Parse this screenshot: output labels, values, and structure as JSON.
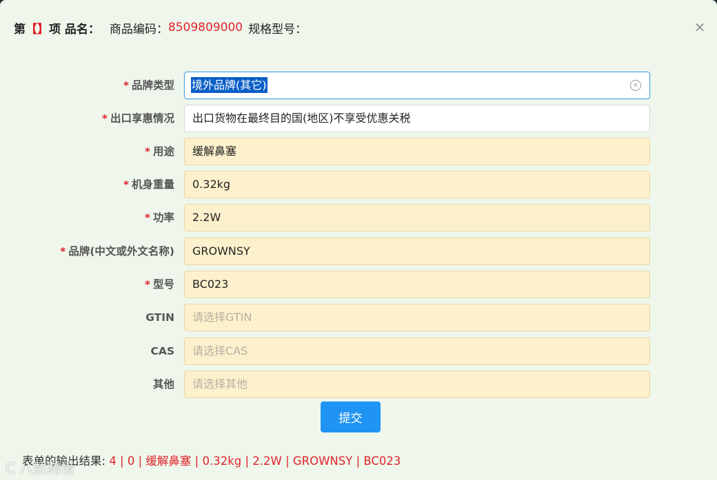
{
  "header": {
    "prefix": "第",
    "bracket": "【】",
    "item_label": "项 品名：",
    "code_label": "商品编码：",
    "code_value": "8509809000",
    "spec_label": "规格型号："
  },
  "close_glyph": "×",
  "form": {
    "rows": [
      {
        "label": "品牌类型",
        "required": true,
        "value": "境外品牌(其它)",
        "placeholder": ""
      },
      {
        "label": "出口享惠情况",
        "required": true,
        "value": "出口货物在最终目的国(地区)不享受优惠关税",
        "placeholder": ""
      },
      {
        "label": "用途",
        "required": true,
        "value": "缓解鼻塞",
        "placeholder": ""
      },
      {
        "label": "机身重量",
        "required": true,
        "value": "0.32kg",
        "placeholder": ""
      },
      {
        "label": "功率",
        "required": true,
        "value": "2.2W",
        "placeholder": ""
      },
      {
        "label": "品牌(中文或外文名称)",
        "required": true,
        "value": "GROWNSY",
        "placeholder": ""
      },
      {
        "label": "型号",
        "required": true,
        "value": "BC023",
        "placeholder": ""
      },
      {
        "label": "GTIN",
        "required": false,
        "value": "",
        "placeholder": "请选择GTIN"
      },
      {
        "label": "CAS",
        "required": false,
        "value": "",
        "placeholder": "请选择CAS"
      },
      {
        "label": "其他",
        "required": false,
        "value": "",
        "placeholder": "请选择其他"
      }
    ],
    "required_mark": "*",
    "clear_glyph": "×"
  },
  "submit_label": "提交",
  "result": {
    "label": "表单的输出结果:",
    "value": "4 | 0 | 缓解鼻塞 | 0.32kg | 2.2W | GROWNSY | BC023"
  },
  "watermark": "C 八数跨境",
  "colors": {
    "required": "#e0242b",
    "accent": "#2094f3",
    "field_bg": "#fdf1cd",
    "dialog_bg": "#eff7ec"
  }
}
